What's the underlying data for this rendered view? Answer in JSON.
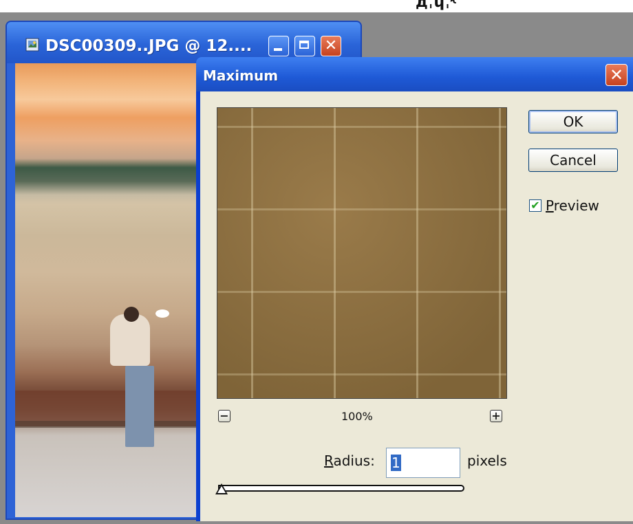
{
  "top_partial_text": "ˈдˌɥˌ˞ ˈ",
  "document_window": {
    "title": "DSC00309..JPG @ 12....",
    "icon": "document-image-icon",
    "buttons": {
      "minimize": "minimize-icon",
      "maximize": "maximize-icon",
      "close": "✕"
    }
  },
  "dialog": {
    "title": "Maximum",
    "close_glyph": "✕",
    "zoom": {
      "minus": "−",
      "plus": "+",
      "level": "100%"
    },
    "radius": {
      "label_underlined": "R",
      "label_rest": "adius:",
      "value": "1",
      "unit": "pixels",
      "slider_fraction": 0.0
    },
    "buttons": {
      "ok": "OK",
      "cancel": "Cancel"
    },
    "preview": {
      "checked": true,
      "check_glyph": "✔",
      "label_underlined": "P",
      "label_rest": "review"
    }
  },
  "colors": {
    "title_blue": "#2a64d8",
    "dialog_face": "#ece9d8",
    "close_red": "#c6421f",
    "selection_blue": "#316ac5"
  }
}
